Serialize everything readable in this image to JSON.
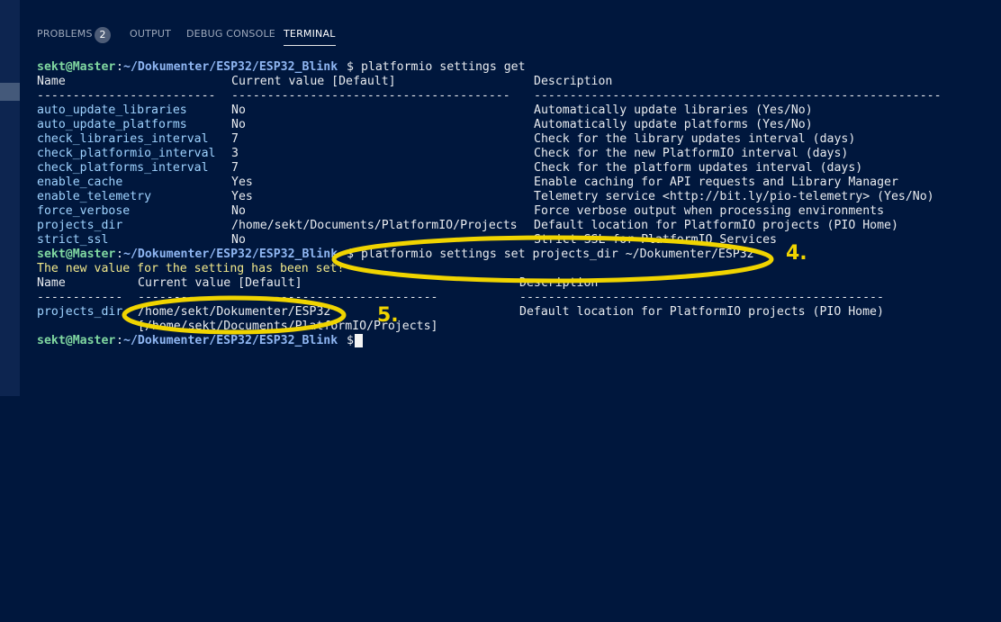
{
  "panel": {
    "tabs": [
      {
        "label": "PROBLEMS",
        "badge": "2"
      },
      {
        "label": "OUTPUT"
      },
      {
        "label": "DEBUG CONSOLE"
      },
      {
        "label": "TERMINAL",
        "active": true
      }
    ]
  },
  "terminal": {
    "prompt": {
      "user": "sekt@Master",
      "sep": ":",
      "path": "~/Dokumenter/ESP32/ESP32_Blink",
      "dollar": "$"
    },
    "cmd1": " platformio settings get",
    "table1": {
      "headers": [
        "Name",
        "Current value [Default]",
        "Description"
      ],
      "dashes": [
        "-------------------------",
        "---------------------------------------",
        "---------------------------------------------------------"
      ],
      "rows": [
        {
          "name": "auto_update_libraries",
          "value": "No",
          "desc": "Automatically update libraries (Yes/No)"
        },
        {
          "name": "auto_update_platforms",
          "value": "No",
          "desc": "Automatically update platforms (Yes/No)"
        },
        {
          "name": "check_libraries_interval",
          "value": "7",
          "desc": "Check for the library updates interval (days)"
        },
        {
          "name": "check_platformio_interval",
          "value": "3",
          "desc": "Check for the new PlatformIO interval (days)"
        },
        {
          "name": "check_platforms_interval",
          "value": "7",
          "desc": "Check for the platform updates interval (days)"
        },
        {
          "name": "enable_cache",
          "value": "Yes",
          "desc": "Enable caching for API requests and Library Manager"
        },
        {
          "name": "enable_telemetry",
          "value": "Yes",
          "desc": "Telemetry service <http://bit.ly/pio-telemetry> (Yes/No)"
        },
        {
          "name": "force_verbose",
          "value": "No",
          "desc": "Force verbose output when processing environments"
        },
        {
          "name": "projects_dir",
          "value": "/home/sekt/Documents/PlatformIO/Projects",
          "desc": "Default location for PlatformIO projects (PIO Home)"
        },
        {
          "name": "strict_ssl",
          "value": "No",
          "desc": "Strict SSL for PlatformIO Services"
        }
      ]
    },
    "cmd2": " platformio settings set projects_dir ~/Dokumenter/ESP32",
    "set_message": "The new value for the setting has been set!",
    "table2": {
      "headers": [
        "Name",
        "Current value [Default]",
        "Description"
      ],
      "dashes": [
        "------------",
        "------------------------------------------",
        "---------------------------------------------------"
      ],
      "row": {
        "name": "projects_dir",
        "value": "/home/sekt/Dokumenter/ESP32",
        "default": "[/home/sekt/Documents/PlatformIO/Projects]",
        "desc": "Default location for PlatformIO projects (PIO Home)"
      }
    },
    "annotations": {
      "step4": "4.",
      "step5": "5."
    },
    "annotation_color": "#f0d400"
  }
}
